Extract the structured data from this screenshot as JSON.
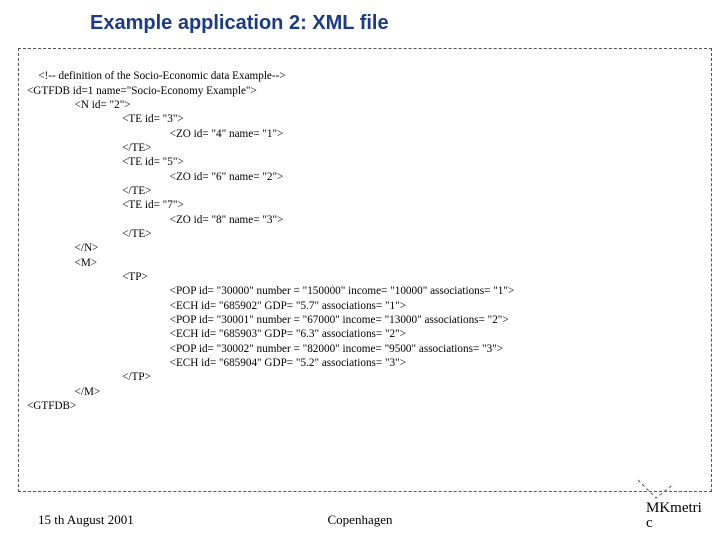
{
  "title": "Example application 2: XML file",
  "xml": "<!-- definition of the Socio-Economic data Example-->\n<GTFDB id=1 name=\"Socio-Economy Example\">\n                 <N id= \"2\">\n                                  <TE id= \"3\">\n                                                   <ZO id= \"4\" name= \"1\">\n                                  </TE>\n                                  <TE id= \"5\">\n                                                   <ZO id= \"6\" name= \"2\">\n                                  </TE>\n                                  <TE id= \"7\">\n                                                   <ZO id= \"8\" name= \"3\">\n                                  </TE>\n                 </N>\n                 <M>\n                                  <TP>\n                                                   <POP id= \"30000\" number = \"150000\" income= \"10000\" associations= \"1\">\n                                                   <ECH id= \"685902\" GDP= \"5.7\" associations= \"1\">\n                                                   <POP id= \"30001\" number = \"67000\" income= \"13000\" associations= \"2\">\n                                                   <ECH id= \"685903\" GDP= \"6.3\" associations= \"2\">\n                                                   <POP id= \"30002\" number = \"82000\" income= \"9500\" associations= \"3\">\n                                                   <ECH id= \"685904\" GDP= \"5.2\" associations= \"3\">\n                                  </TP>\n                 </M>\n<GTFDB>",
  "footer": {
    "left": "15 th August 2001",
    "center": "Copenhagen",
    "right_line1": "MKmetri",
    "right_line2": "c"
  }
}
